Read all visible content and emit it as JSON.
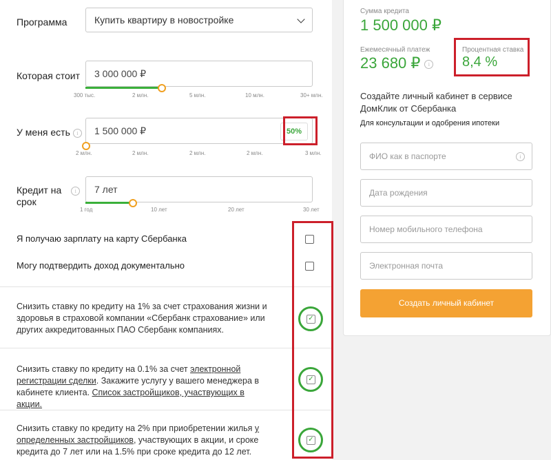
{
  "form": {
    "program": {
      "label": "Программа",
      "value": "Купить квартиру в новостройке"
    },
    "price": {
      "label": "Которая стоит",
      "value": "3 000 000 ₽",
      "ticks": [
        "300 тыс.",
        "2 млн.",
        "5 млн.",
        "10 млн.",
        "30+ млн."
      ],
      "slider_fraction": 0.32
    },
    "down": {
      "label": "У меня есть",
      "value": "1 500 000 ₽",
      "percent": "50%",
      "ticks": [
        "2 млн.",
        "2 млн.",
        "2 млн.",
        "2 млн.",
        "3 млн."
      ],
      "slider_fraction": 0.0
    },
    "term": {
      "label_line1": "Кредит на",
      "label_line2": "срок",
      "value": "7 лет",
      "ticks": [
        "1 год",
        "10 лет",
        "20 лет",
        "30 лет"
      ],
      "slider_fraction": 0.21
    },
    "checks": [
      {
        "label": "Я получаю зарплату на карту Сбербанка"
      },
      {
        "label": "Могу подтвердить доход документально"
      }
    ],
    "discounts": {
      "d1": "Снизить ставку по кредиту на 1% за счет страхования жизни и здоровья в страховой компании «Сбербанк страхование» или других аккредитованных ПАО Сбербанк компаниях.",
      "d2_pre": "Снизить ставку по кредиту на 0.1% за счет ",
      "d2_link1": "электронной регистрации сделки",
      "d2_mid": ". Закажите услугу у вашего менеджера в кабинете клиента. ",
      "d2_link2": "Список застройщиков, участвующих в акции.",
      "d3_pre": "Снизить ставку по кредиту на 2% при приобретении жилья ",
      "d3_link": "у определенных застройщиков",
      "d3_post": ", участвующих в акции, и сроке кредита до 7 лет или на 1.5% при сроке кредита до 12 лет."
    }
  },
  "summary": {
    "loan_label": "Сумма кредита",
    "loan_value": "1 500 000 ₽",
    "monthly_label": "Ежемесячный платеж",
    "monthly_value": "23 680 ₽",
    "rate_label": "Процентная ставка",
    "rate_value": "8,4 %",
    "cabinet_title": "Создайте личный кабинет в сервисе ДомКлик от Сбербанка",
    "cabinet_subtitle": "Для консультации и одобрения ипотеки",
    "fields": {
      "fio": "ФИО как в паспорте",
      "birth": "Дата рождения",
      "phone": "Номер мобильного телефона",
      "email": "Электронная почта"
    },
    "submit": "Создать личный кабинет"
  },
  "colors": {
    "accent_green": "#3aa63a",
    "slider_green": "#3ab03a",
    "button_orange": "#f4a233",
    "highlight_red": "#cc1f2a"
  }
}
